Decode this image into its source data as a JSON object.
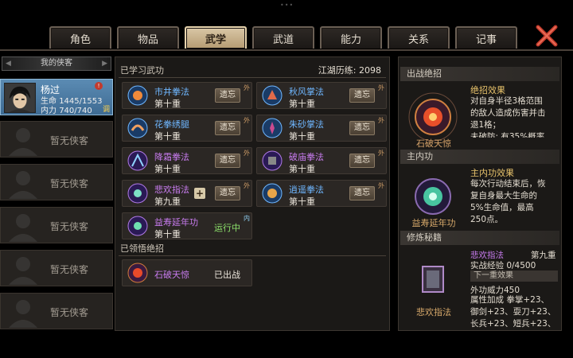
{
  "tabs": [
    "角色",
    "物品",
    "武学",
    "武道",
    "能力",
    "关系",
    "记事"
  ],
  "active_tab": "武学",
  "character_list": {
    "header": "我的侠客",
    "selected": {
      "name": "杨过",
      "hp_label": "生命",
      "hp": "1445/1553",
      "mp_label": "内力",
      "mp": "740/740",
      "adjust": "调",
      "badge": "!"
    },
    "empty_label": "暂无侠客"
  },
  "learned": {
    "section_title": "已学习武功",
    "jianghu_label": "江湖历练:",
    "jianghu_value": "2098",
    "forget_label": "遗忘",
    "skills": [
      {
        "name": "市井拳法",
        "level": "第十重",
        "tag": "外",
        "color": "blue"
      },
      {
        "name": "秋风掌法",
        "level": "第十重",
        "tag": "外",
        "color": "blue"
      },
      {
        "name": "花拳绣腿",
        "level": "第十重",
        "tag": "外",
        "color": "blue"
      },
      {
        "name": "朱砂掌法",
        "level": "第十重",
        "tag": "外",
        "color": "blue"
      },
      {
        "name": "降霜拳法",
        "level": "第十重",
        "tag": "外",
        "color": "purple"
      },
      {
        "name": "破庙拳法",
        "level": "第十重",
        "tag": "外",
        "color": "purple"
      },
      {
        "name": "悲欢指法",
        "level": "第九重",
        "tag": "外",
        "color": "purple"
      },
      {
        "name": "逍遥拳法",
        "level": "第十重",
        "tag": "外",
        "color": "blue"
      }
    ],
    "inner_skill": {
      "name": "益寿延年功",
      "level": "第十重",
      "tag": "内",
      "status": "运行中"
    }
  },
  "ultimate": {
    "section_title": "已领悟绝招",
    "name": "石破天惊",
    "status": "已出战"
  },
  "right_panel": {
    "battle_ult": {
      "header": "出战绝招",
      "title": "绝招效果",
      "desc": [
        "对自身半径3格范围",
        "的敌人造成伤害并击",
        "退1格；",
        "未破防: 有35%概率"
      ],
      "emblem_label": "石破天惊"
    },
    "inner": {
      "header": "主内功",
      "title": "主内功效果",
      "desc": [
        "每次行动结束后，恢",
        "复自身最大生命的",
        "5%生命值，最高",
        "250点。"
      ],
      "emblem_label": "益寿延年功"
    },
    "training": {
      "header": "修炼秘籍",
      "skill_name": "悲欢指法",
      "level": "第九重",
      "exp_label": "实战经验",
      "exp_value": "0/4500",
      "next_label": "下一重效果",
      "power": "外功威力450",
      "attr_lines": [
        "属性加成 拳掌+23、",
        "御剑+23、耍刀+23、",
        "长兵+23、短兵+23、"
      ],
      "emblem_label": "悲欢指法"
    }
  },
  "colors": {
    "accent_gold": "#e8c36b",
    "skill_blue": "#6fb7ff",
    "skill_purple": "#c97cf0",
    "running_green": "#8de36b",
    "selected_card": "#4a79a2"
  }
}
